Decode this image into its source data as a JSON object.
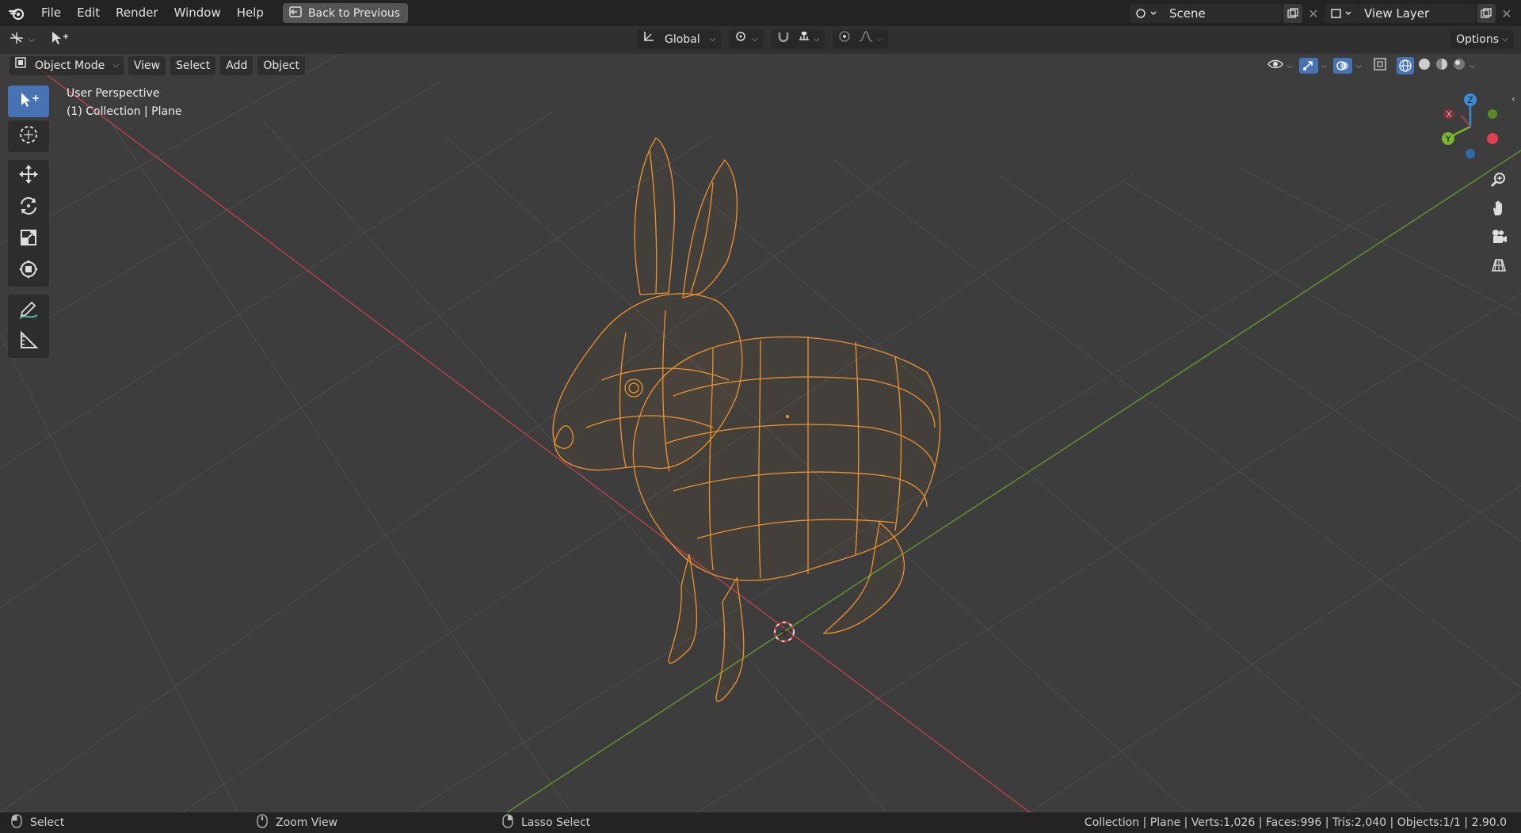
{
  "menu": {
    "file": "File",
    "edit": "Edit",
    "render": "Render",
    "window": "Window",
    "help": "Help",
    "back_button": "Back to Previous"
  },
  "scene": {
    "name": "Scene"
  },
  "view_layer": {
    "name": "View Layer"
  },
  "header": {
    "transform_orientation": "Global",
    "options": "Options"
  },
  "viewport_header": {
    "mode": "Object Mode",
    "view": "View",
    "select": "Select",
    "add": "Add",
    "object": "Object"
  },
  "overlay": {
    "perspective": "User Perspective",
    "collection": "(1) Collection | Plane"
  },
  "gizmo": {
    "x": "X",
    "y": "Y",
    "z": "Z"
  },
  "statusbar": {
    "left_action": "Select",
    "middle_action": "Zoom View",
    "right_action": "Lasso Select",
    "stats": "Collection | Plane | Verts:1,026 | Faces:996 | Tris:2,040 | Objects:1/1 | 2.90.0"
  },
  "colors": {
    "accent": "#4772b3",
    "wire": "#f0922b",
    "x_axis": "#c0434f",
    "y_axis": "#6b9a2d",
    "gizmo_x": "#e0404f",
    "gizmo_y": "#7ab52f",
    "gizmo_z": "#3a8ed9"
  },
  "icons": {
    "logo": "blender-logo-icon",
    "tools": [
      "select-box-icon",
      "cursor-icon",
      "move-icon",
      "rotate-icon",
      "scale-icon",
      "transform-icon",
      "annotate-icon",
      "measure-icon"
    ],
    "nav": [
      "zoom-icon",
      "pan-hand-icon",
      "camera-icon",
      "grid-ortho-icon"
    ]
  }
}
